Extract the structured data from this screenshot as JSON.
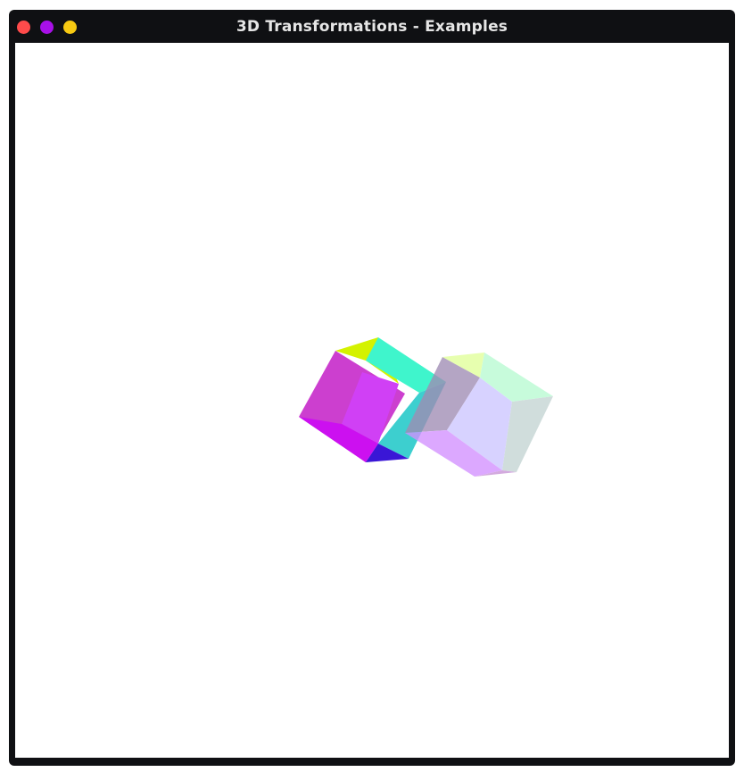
{
  "window": {
    "title": "3D Transformations - Examples",
    "buttons": [
      {
        "name": "close",
        "color": "#ff4b4b"
      },
      {
        "name": "minimize",
        "color": "#a810e8"
      },
      {
        "name": "maximize",
        "color": "#f7c912"
      }
    ]
  },
  "scene": {
    "background": "#ffffff",
    "cubes": [
      {
        "name": "solid-cube",
        "opacity": "opaque",
        "faces": [
          {
            "name": "left",
            "color": "#cc3fcf"
          },
          {
            "name": "front",
            "color": "#d040f5"
          },
          {
            "name": "top",
            "color": "#d4f200"
          },
          {
            "name": "back-top",
            "color": "#3ff5cc"
          },
          {
            "name": "right",
            "color": "#3dcfcf"
          },
          {
            "name": "bottom",
            "color": "#cc10f0"
          },
          {
            "name": "bottom-corner",
            "color": "#3a16d6"
          }
        ]
      },
      {
        "name": "transparent-cube",
        "opacity": "semi-transparent",
        "faces": [
          {
            "name": "left",
            "color": "#a08cb4"
          },
          {
            "name": "front",
            "color": "#cdc6ff"
          },
          {
            "name": "top",
            "color": "#e1ff99"
          },
          {
            "name": "back-top",
            "color": "#b8fbd2"
          },
          {
            "name": "right",
            "color": "#c3d4d3"
          },
          {
            "name": "bottom",
            "color": "#d390ff"
          },
          {
            "name": "bottom-corner",
            "color": "#c793d6"
          }
        ]
      }
    ]
  }
}
